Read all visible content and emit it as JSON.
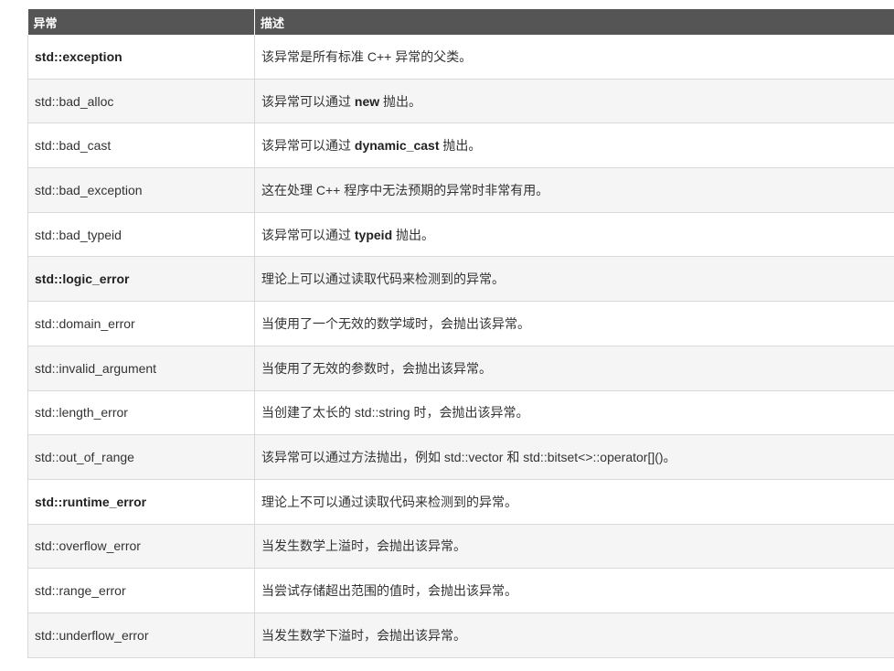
{
  "table": {
    "headers": [
      "异常",
      "描述"
    ],
    "rows": [
      {
        "name": "std::exception",
        "bold": true,
        "desc": [
          "该异常是所有标准 C++ 异常的父类。"
        ]
      },
      {
        "name": "std::bad_alloc",
        "bold": false,
        "desc": [
          "该异常可以通过 ",
          "new",
          " 抛出。"
        ]
      },
      {
        "name": "std::bad_cast",
        "bold": false,
        "desc": [
          "该异常可以通过 ",
          "dynamic_cast",
          " 抛出。"
        ]
      },
      {
        "name": "std::bad_exception",
        "bold": false,
        "desc": [
          "这在处理 C++ 程序中无法预期的异常时非常有用。"
        ]
      },
      {
        "name": "std::bad_typeid",
        "bold": false,
        "desc": [
          "该异常可以通过 ",
          "typeid",
          " 抛出。"
        ]
      },
      {
        "name": "std::logic_error",
        "bold": true,
        "desc": [
          "理论上可以通过读取代码来检测到的异常。"
        ]
      },
      {
        "name": "std::domain_error",
        "bold": false,
        "desc": [
          "当使用了一个无效的数学域时，会抛出该异常。"
        ]
      },
      {
        "name": "std::invalid_argument",
        "bold": false,
        "desc": [
          "当使用了无效的参数时，会抛出该异常。"
        ]
      },
      {
        "name": "std::length_error",
        "bold": false,
        "desc": [
          "当创建了太长的 std::string 时，会抛出该异常。"
        ]
      },
      {
        "name": "std::out_of_range",
        "bold": false,
        "desc": [
          "该异常可以通过方法抛出，例如 std::vector 和 std::bitset<>::operator[]()。"
        ]
      },
      {
        "name": "std::runtime_error",
        "bold": true,
        "desc": [
          "理论上不可以通过读取代码来检测到的异常。"
        ]
      },
      {
        "name": "std::overflow_error",
        "bold": false,
        "desc": [
          "当发生数学上溢时，会抛出该异常。"
        ]
      },
      {
        "name": "std::range_error",
        "bold": false,
        "desc": [
          "当尝试存储超出范围的值时，会抛出该异常。"
        ]
      },
      {
        "name": "std::underflow_error",
        "bold": false,
        "desc": [
          "当发生数学下溢时，会抛出该异常。"
        ]
      }
    ]
  },
  "colors": {
    "header_bg": "#555555",
    "row_alt_bg": "#f5f5f5",
    "border": "#d9d9d9"
  }
}
